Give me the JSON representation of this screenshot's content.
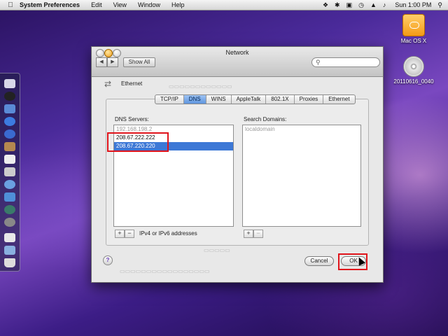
{
  "menubar": {
    "app_name": "System Preferences",
    "menus": [
      "Edit",
      "View",
      "Window",
      "Help"
    ],
    "clock": "Sun 1:00 PM"
  },
  "desktop": {
    "icons": [
      {
        "label": "Mac OS X",
        "icon": "hard-drive-icon"
      },
      {
        "label": "20110616_0040",
        "icon": "cd-icon"
      }
    ]
  },
  "window": {
    "title": "Network",
    "show_all": "Show All",
    "search_placeholder": ""
  },
  "sheet": {
    "interface": "Ethernet",
    "tabs": [
      "TCP/IP",
      "DNS",
      "WINS",
      "AppleTalk",
      "802.1X",
      "Proxies",
      "Ethernet"
    ],
    "active_tab": "DNS",
    "dns_label": "DNS Servers:",
    "dns_servers": [
      "192.168.198.2",
      "208.67.222.222",
      "208.67.220.220"
    ],
    "search_label": "Search Domains:",
    "search_domains": [
      "localdomain"
    ],
    "hint": "IPv4 or IPv6 addresses",
    "cancel": "Cancel",
    "ok": "OK",
    "help": "?"
  },
  "colors": {
    "highlight_red": "#e0141b",
    "selection_blue": "#3d78d6"
  }
}
